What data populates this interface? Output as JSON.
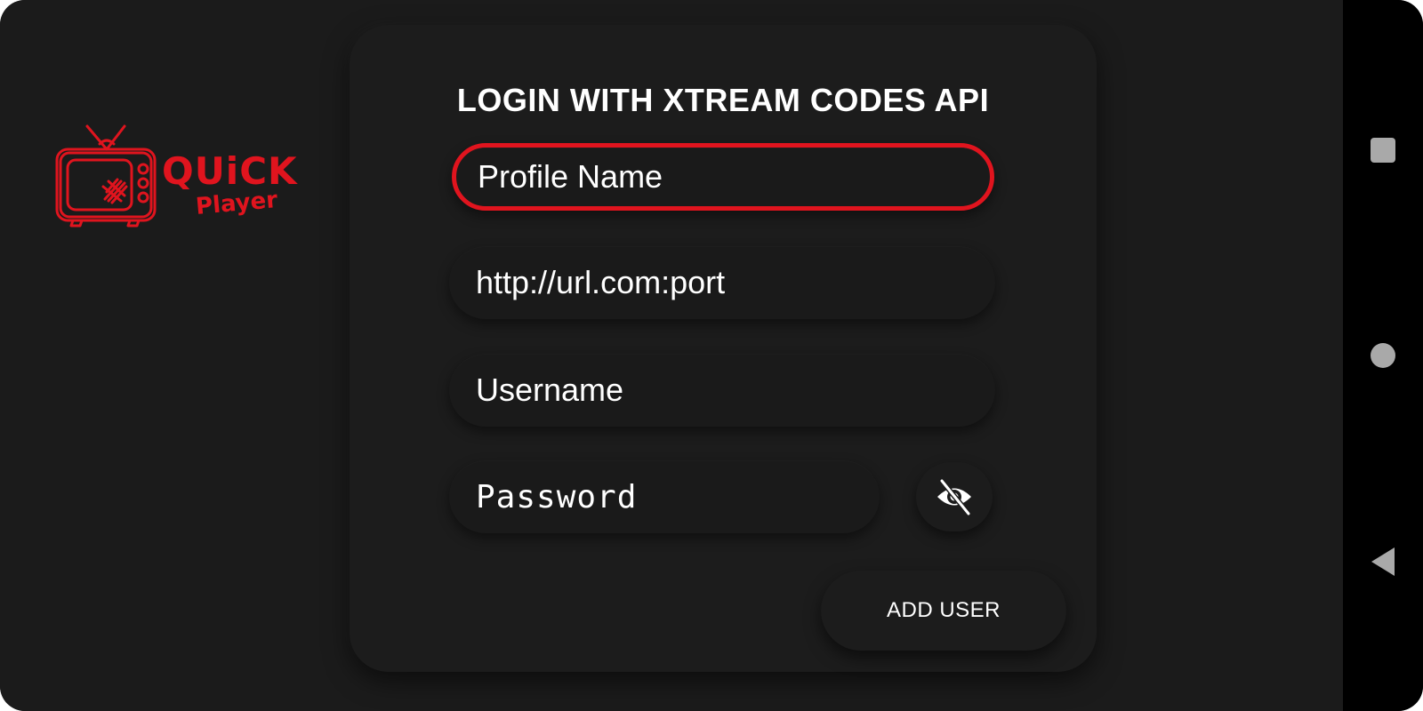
{
  "app": {
    "logo": {
      "word1": "QUiCK",
      "word2": "Player",
      "color": "#e0141e",
      "icon": "tv-icon"
    }
  },
  "login": {
    "title": "LOGIN WITH XTREAM CODES API",
    "fields": {
      "profile_name": {
        "placeholder": "Profile Name"
      },
      "url": {
        "placeholder": "http://url.com:port"
      },
      "username": {
        "placeholder": "Username"
      },
      "password": {
        "placeholder": "Password"
      }
    },
    "visibility_toggle_icon": "eye-off-icon",
    "add_user_label": "ADD USER"
  },
  "colors": {
    "background": "#1b1b1b",
    "accent": "#e0141e",
    "text": "#ffffff",
    "nav_bar": "#000000"
  },
  "system_nav": {
    "icons": [
      "recents-icon",
      "home-icon",
      "back-icon"
    ]
  }
}
